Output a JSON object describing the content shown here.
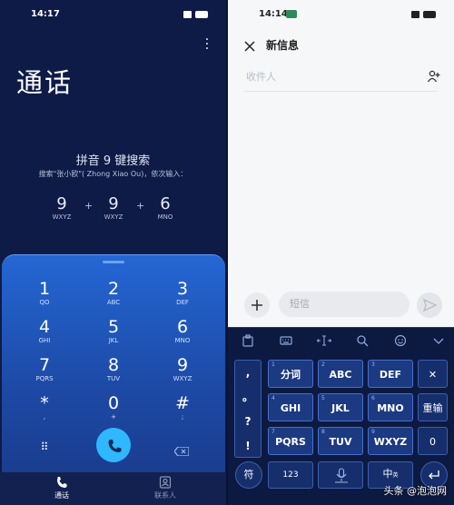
{
  "left": {
    "status_time": "14:17",
    "title": "通话",
    "hint_title": "拼音 9 键搜索",
    "hint_sub": "搜索\"张小欧\"( Zhong Xiao Ou)，依次输入：",
    "example": [
      {
        "digit": "9",
        "letters": "WXYZ"
      },
      {
        "digit": "9",
        "letters": "WXYZ"
      },
      {
        "digit": "6",
        "letters": "MNO"
      }
    ],
    "plus": "+",
    "keys": [
      {
        "digit": "1",
        "letters": "QO"
      },
      {
        "digit": "2",
        "letters": "ABC"
      },
      {
        "digit": "3",
        "letters": "DEF"
      },
      {
        "digit": "4",
        "letters": "GHI"
      },
      {
        "digit": "5",
        "letters": "JKL"
      },
      {
        "digit": "6",
        "letters": "MNO"
      },
      {
        "digit": "7",
        "letters": "PQRS"
      },
      {
        "digit": "8",
        "letters": "TUV"
      },
      {
        "digit": "9",
        "letters": "WXYZ"
      },
      {
        "digit": "*",
        "letters": ","
      },
      {
        "digit": "0",
        "letters": "+"
      },
      {
        "digit": "#",
        "letters": ";"
      }
    ],
    "nav": {
      "calls": "通话",
      "contacts": "联系人"
    },
    "keypad_glyph": "⠿"
  },
  "right": {
    "status_time": "14:14",
    "title": "新信息",
    "recipient_placeholder": "收件人",
    "message_placeholder": "短信",
    "kb_side": [
      ",",
      "。",
      "?",
      "!"
    ],
    "kb_keys": [
      {
        "num": "1",
        "main": "分词"
      },
      {
        "num": "2",
        "main": "ABC"
      },
      {
        "num": "3",
        "main": "DEF"
      },
      {
        "num": "4",
        "main": "GHI"
      },
      {
        "num": "5",
        "main": "JKL"
      },
      {
        "num": "6",
        "main": "MNO"
      },
      {
        "num": "7",
        "main": "PQRS"
      },
      {
        "num": "8",
        "main": "TUV"
      },
      {
        "num": "9",
        "main": "WXYZ"
      }
    ],
    "kb_delete": "✕",
    "kb_reenter": "重输",
    "kb_zero": "0",
    "kb_symbol": "符",
    "kb_123": "123",
    "kb_lang": "中",
    "kb_lang_sub": "英",
    "watermark": "头条 @泡泡网"
  },
  "colors": {
    "dial_bg": "#0e1b46",
    "pad_top": "#2467d4",
    "call_button": "#2fb7ff",
    "kb_bg": "#0c1a42",
    "kb_key": "#1c3a82",
    "kb_border": "#4a6fc9"
  }
}
